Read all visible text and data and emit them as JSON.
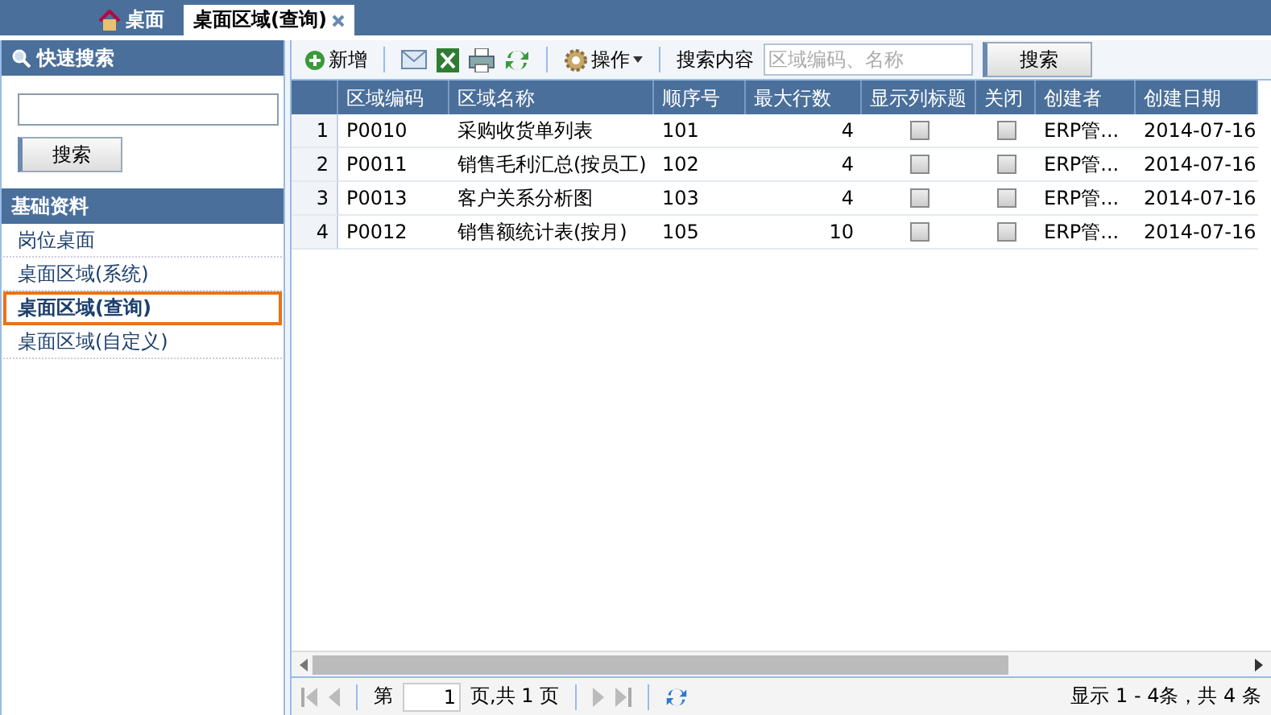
{
  "tabs": [
    {
      "label": "桌面",
      "kind": "home",
      "selected": false
    },
    {
      "label": "桌面区域(查询)",
      "kind": "closable",
      "selected": true
    }
  ],
  "sidebar": {
    "quick_search": {
      "title": "快速搜索",
      "button": "搜索"
    },
    "section": {
      "title": "基础资料",
      "items": [
        {
          "label": "岗位桌面",
          "selected": false
        },
        {
          "label": "桌面区域(系统)",
          "selected": false
        },
        {
          "label": "桌面区域(查询)",
          "selected": true
        },
        {
          "label": "桌面区域(自定义)",
          "selected": false
        }
      ]
    }
  },
  "toolbar": {
    "buttons": [
      {
        "kind": "add",
        "label": "新增"
      },
      {
        "kind": "mail"
      },
      {
        "kind": "excel"
      },
      {
        "kind": "print"
      },
      {
        "kind": "refresh"
      },
      {
        "kind": "menu",
        "label": "操作"
      }
    ],
    "search_label": "搜索内容",
    "search_placeholder": "区域编码、名称",
    "search_button": "搜索"
  },
  "table": {
    "columns": [
      "区域编码",
      "区域名称",
      "顺序号",
      "最大行数",
      "显示列标题",
      "关闭",
      "创建者",
      "创建日期"
    ],
    "rows": [
      {
        "index": "1",
        "code": "P0010",
        "name": "采购收货单列表",
        "order": "101",
        "max_rows": "4",
        "show_title": false,
        "closed": false,
        "creator": "ERP管...",
        "date": "2014-07-16"
      },
      {
        "index": "2",
        "code": "P0011",
        "name": "销售毛利汇总(按员工)",
        "order": "102",
        "max_rows": "4",
        "show_title": false,
        "closed": false,
        "creator": "ERP管...",
        "date": "2014-07-16"
      },
      {
        "index": "3",
        "code": "P0013",
        "name": "客户关系分析图",
        "order": "103",
        "max_rows": "4",
        "show_title": false,
        "closed": false,
        "creator": "ERP管...",
        "date": "2014-07-16"
      },
      {
        "index": "4",
        "code": "P0012",
        "name": "销售额统计表(按月)",
        "order": "105",
        "max_rows": "10",
        "show_title": false,
        "closed": false,
        "creator": "ERP管...",
        "date": "2014-07-16"
      }
    ]
  },
  "pager": {
    "before": "第",
    "page": "1",
    "after": "页,共 1 页",
    "summary": "显示 1 - 4条，共 4 条"
  }
}
